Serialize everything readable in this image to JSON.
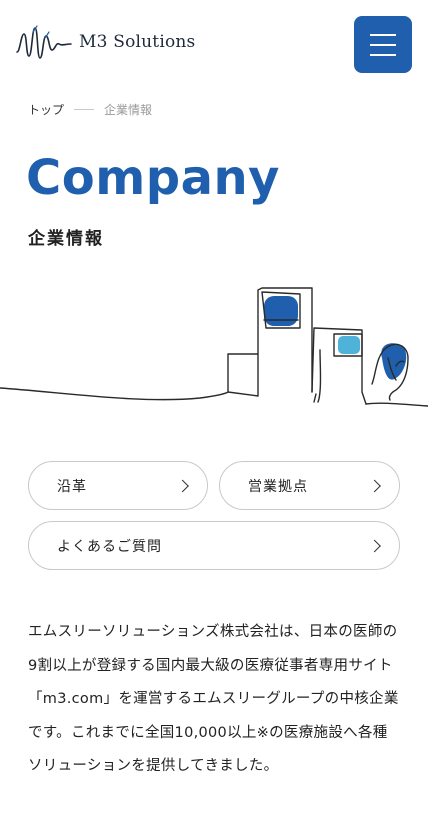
{
  "header": {
    "logo_text": "M3 Solutions",
    "menu_icon": "hamburger-menu-icon",
    "accent_color": "#1f5fae"
  },
  "breadcrumb": {
    "home": "トップ",
    "current": "企業情報"
  },
  "page": {
    "title": "Company",
    "subtitle": "企業情報"
  },
  "nav_buttons": [
    {
      "label": "沿革",
      "icon": "chevron-right-icon"
    },
    {
      "label": "営業拠点",
      "icon": "chevron-right-icon"
    },
    {
      "label": "よくあるご質問",
      "icon": "chevron-right-icon"
    }
  ],
  "intro": {
    "text": "エムスリーソリューションズ株式会社は、日本の医師の9割以上が登録する国内最大級の医療従事者専用サイト「m3.com」を運営するエムスリーグループの中核企業です。これまでに全国10,000以上※の医療施設へ各種ソリューションを提供してきました。"
  }
}
